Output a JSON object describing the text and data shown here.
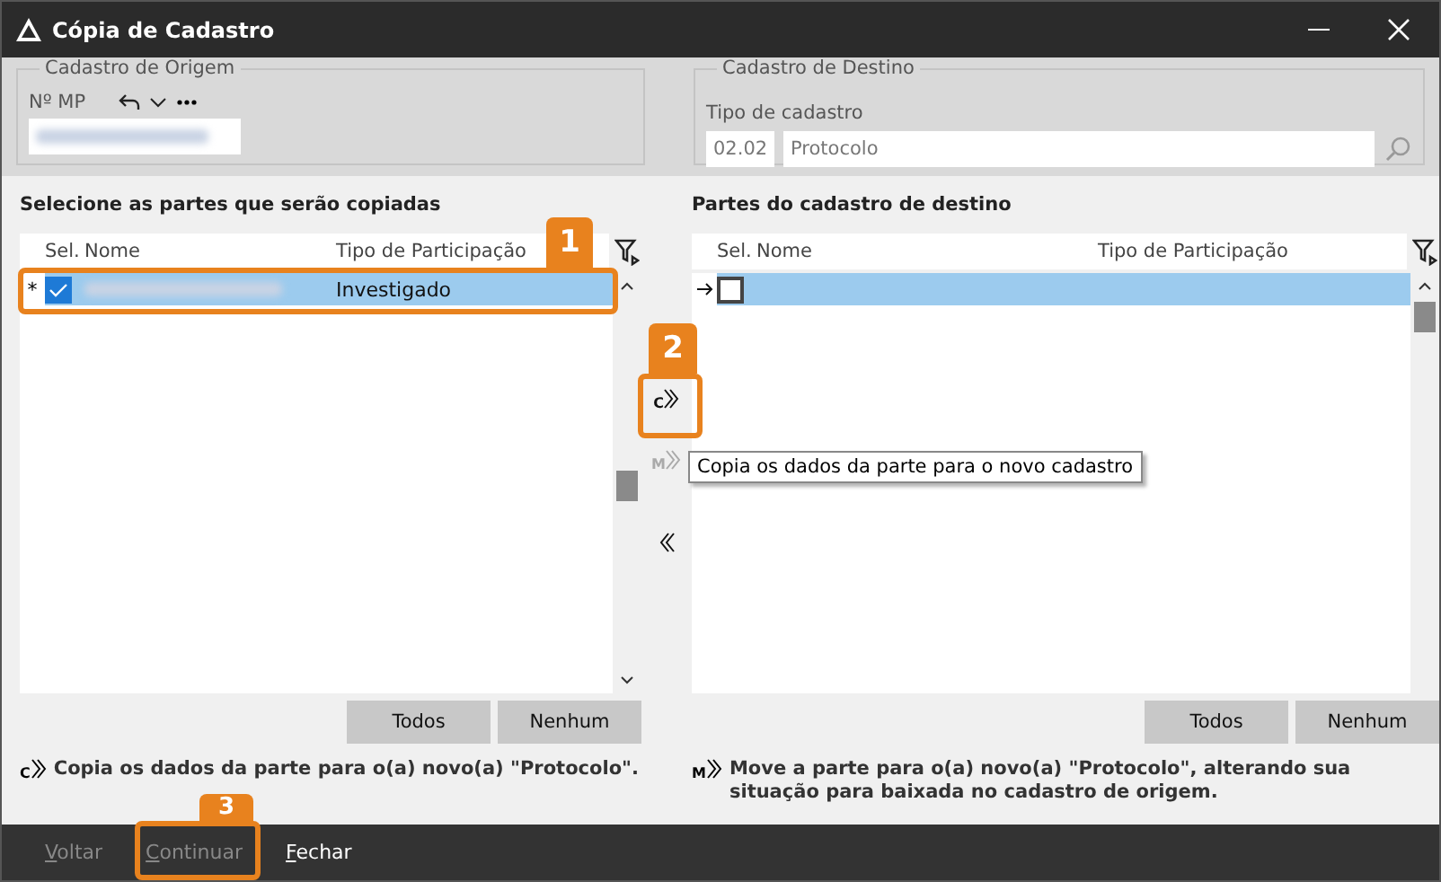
{
  "window": {
    "title": "Cópia de Cadastro"
  },
  "origin": {
    "legend": "Cadastro de Origem",
    "field_label": "Nº MP"
  },
  "destination": {
    "legend": "Cadastro de Destino",
    "field_label": "Tipo de cadastro",
    "code": "02.02",
    "name": "Protocolo"
  },
  "source_list": {
    "title": "Selecione as partes que serão copiadas",
    "columns": [
      "Sel.",
      "Nome",
      "Tipo de Participação"
    ],
    "rows": [
      {
        "kind": "new",
        "indicator": "*",
        "checked": true,
        "selected": true,
        "participation": "Investigado"
      }
    ],
    "buttons": [
      "Todos",
      "Nenhum"
    ],
    "legend_letter": "C",
    "legend_text": "Copia os dados da parte para o(a) novo(a) \"Protocolo\"."
  },
  "transfer_buttons": [
    {
      "kind": "copy",
      "letter": "C",
      "disabled": false
    },
    {
      "kind": "move",
      "letter": "M",
      "disabled": true
    },
    {
      "kind": "back",
      "disabled": false
    }
  ],
  "tooltip": "Copia os dados da parte para o novo cadastro",
  "target_list": {
    "title": "Partes do cadastro de destino",
    "columns": [
      "Sel.",
      "Nome",
      "Tipo de Participação"
    ],
    "rows": [
      {
        "kind": "current",
        "checked": false,
        "selected": true,
        "participation": ""
      }
    ],
    "buttons": [
      "Todos",
      "Nenhum"
    ],
    "legend_letter": "M",
    "legend_text": "Move a parte para o(a) novo(a) \"Protocolo\", alterando sua situação para baixada no cadastro de origem."
  },
  "footer_buttons": [
    {
      "label": "Voltar",
      "disabled": true
    },
    {
      "label": "Continuar",
      "disabled": true
    },
    {
      "label": "Fechar",
      "disabled": false
    }
  ],
  "callouts": [
    {
      "label": "1"
    },
    {
      "label": "2"
    },
    {
      "label": "3"
    }
  ]
}
